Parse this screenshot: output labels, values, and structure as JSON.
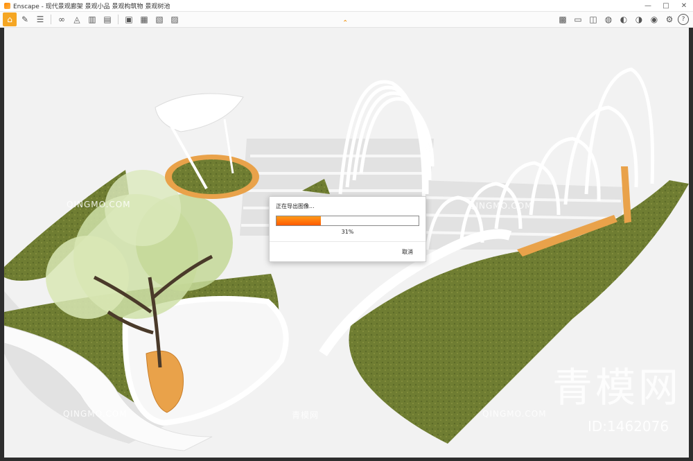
{
  "window": {
    "title": "Enscape - 现代景观廊架 景观小品 景观构筑物 景观树池",
    "minimize": "—",
    "maximize": "□",
    "close": "✕"
  },
  "toolbar": {
    "left_icons": [
      "home-icon",
      "pen-icon",
      "list-icon",
      "binoculars-icon",
      "map-pin-icon",
      "buildings-icon",
      "clapperboard-icon",
      "export-image-icon",
      "batch-export-icon",
      "export-video-icon",
      "export-panorama-icon"
    ],
    "right_icons": [
      "library-icon",
      "screenshot-icon",
      "cube-icon",
      "material-icon",
      "settings-icon",
      "vr-icon",
      "visibility-icon",
      "gear-icon",
      "help-icon"
    ],
    "help_label": "?"
  },
  "dialog": {
    "title": "正在导出图像...",
    "progress": 0.31,
    "percent_label": "31%",
    "cancel_label": "取消"
  },
  "watermarks": {
    "site_en": "QINGMO.COM",
    "site_cn": "青模网",
    "big_cn": "青模网",
    "id_label": "ID:1462076"
  },
  "scene": {
    "ground_color": "#f3f3f3",
    "grass_color": "#6b7a30",
    "wood_color": "#e9a24a",
    "structure_color": "#ffffff"
  }
}
